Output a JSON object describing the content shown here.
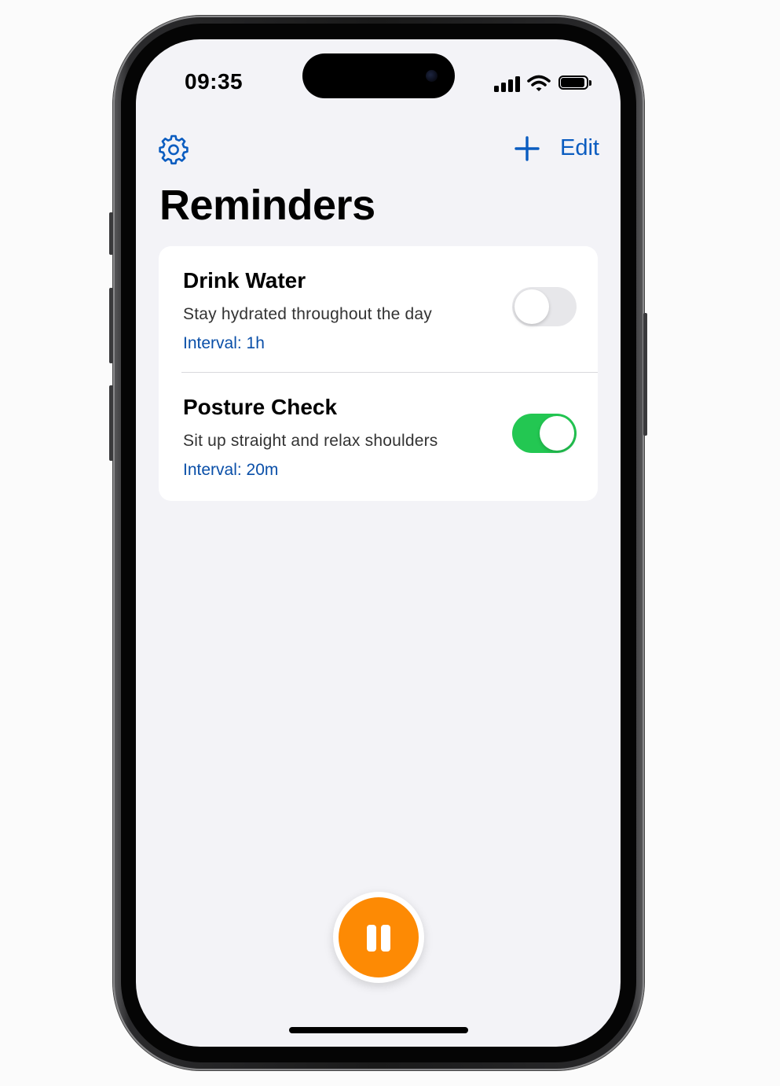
{
  "status_bar": {
    "time": "09:35",
    "signal_icon": "cellular-signal-icon",
    "wifi_icon": "wifi-icon",
    "battery_icon": "battery-icon",
    "battery_level": 1.0
  },
  "nav": {
    "settings_icon": "gear-icon",
    "add_icon": "plus-icon",
    "edit_label": "Edit",
    "accent_color": "#0a5cc0"
  },
  "page": {
    "title": "Reminders"
  },
  "reminders": [
    {
      "title": "Drink Water",
      "subtitle": "Stay hydrated throughout the day",
      "interval": "Interval: 1h",
      "enabled": false
    },
    {
      "title": "Posture Check",
      "subtitle": "Sit up straight and relax shoulders",
      "interval": "Interval: 20m",
      "enabled": true
    }
  ],
  "controls": {
    "pause_icon": "pause-icon",
    "pause_color": "#fd8a04",
    "toggle_on_color": "#23c752"
  }
}
